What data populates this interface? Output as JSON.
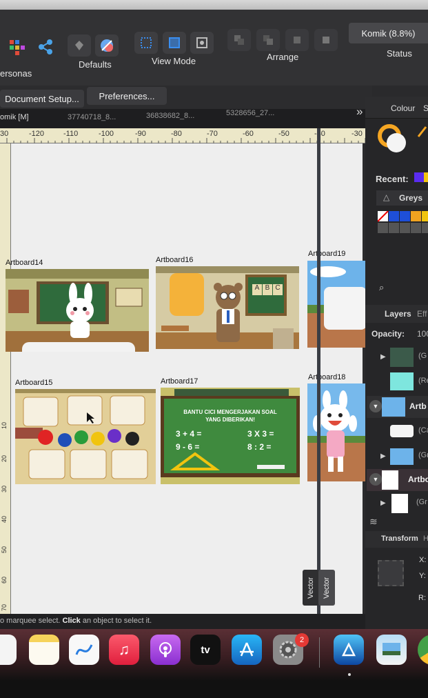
{
  "toolbar": {
    "personas_label": "ersonas",
    "defaults_label": "Defaults",
    "view_mode_label": "View Mode",
    "arrange_label": "Arrange",
    "status_label": "Status",
    "doc_status": "Komik (8.8%)"
  },
  "context_bar": {
    "document_setup": "Document Setup...",
    "preferences": "Preferences..."
  },
  "tabs": [
    "omik [M]",
    "37740718_8...",
    "36838682_8...",
    "5328656_27..."
  ],
  "tabs_more": "»",
  "ruler_top": [
    "30",
    "-120",
    "-110",
    "-100",
    "-90",
    "-80",
    "-70",
    "-60",
    "-50",
    "-40",
    "-30"
  ],
  "ruler_left": [
    "10",
    "20",
    "30",
    "40",
    "50",
    "60",
    "70"
  ],
  "artboards": {
    "a14": "Artboard14",
    "a16": "Artboard16",
    "a19": "Artboard19",
    "a15": "Artboard15",
    "a17": "Artboard17",
    "a18": "Artboard18"
  },
  "chalkboard": {
    "title_line1": "BANTU CICI MENGERJAKAN SOAL",
    "title_line2": "YANG DIBERIKAN!",
    "eq1": "3 + 4 =",
    "eq2": "3 X 3 =",
    "eq3": "9 - 6 =",
    "eq4": "8 : 2 ="
  },
  "abc_blocks": [
    "A",
    "B",
    "C"
  ],
  "vector_badges": [
    "Vector",
    "Vector"
  ],
  "status_message": {
    "prefix": "o marquee select. ",
    "bold": "Click",
    "suffix": " an object to select it."
  },
  "right_panel": {
    "colour_tab": "Colour",
    "colour_tab_cut": "S",
    "recent_label": "Recent:",
    "greys_label": "Greys",
    "layers_tab": "Layers",
    "effects_tab": "Eff",
    "opacity_label": "Opacity:",
    "opacity_value": "100",
    "layer_rows": [
      "(G",
      "(Re",
      "Artb",
      "(Ca",
      "(Gr",
      "Artbo",
      "(Gr"
    ],
    "transform_tab": "Transform",
    "transform_tab_cut": "H",
    "x_label": "X:",
    "y_label": "Y:",
    "r_label": "R:"
  },
  "dock": {
    "settings_badge": "2",
    "tv_label": "tv"
  },
  "colors": {
    "accent_orange": "#f5a623",
    "badge_red": "#e53935",
    "canvas_bg": "#eeeeee"
  }
}
